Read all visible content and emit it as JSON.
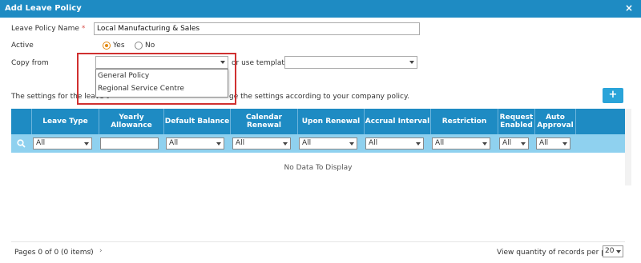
{
  "window": {
    "title": "Add Leave Policy",
    "close": "×"
  },
  "form": {
    "policy_name_label": "Leave Policy Name",
    "required_mark": "*",
    "policy_name_value": "Local Manufacturing & Sales",
    "active_label": "Active",
    "active_yes": "Yes",
    "active_no": "No",
    "active_selected": "Yes",
    "copy_from_label": "Copy from",
    "copy_from_value": "",
    "or_use_template": "or use template",
    "template_value": ""
  },
  "dropdown": {
    "options": [
      "General Policy",
      "Regional Service Centre"
    ]
  },
  "info_text": {
    "left": "The settings for the leave t",
    "right": "ge the settings according to your company policy."
  },
  "add_button": "+",
  "grid": {
    "columns": [
      "Leave Type",
      "Yearly Allowance",
      "Default Balance",
      "Calendar Renewal",
      "Upon Renewal",
      "Accrual Interval",
      "Restriction",
      "Request Enabled",
      "Auto Approval"
    ],
    "filters": [
      "All",
      "",
      "All",
      "All",
      "All",
      "All",
      "All",
      "All",
      "All"
    ],
    "no_data": "No Data To Display"
  },
  "footer": {
    "pages": "Pages 0 of 0 (0 items)",
    "prev": "‹",
    "next": "›",
    "records_label": "View quantity of records per page",
    "records_value": "20"
  }
}
